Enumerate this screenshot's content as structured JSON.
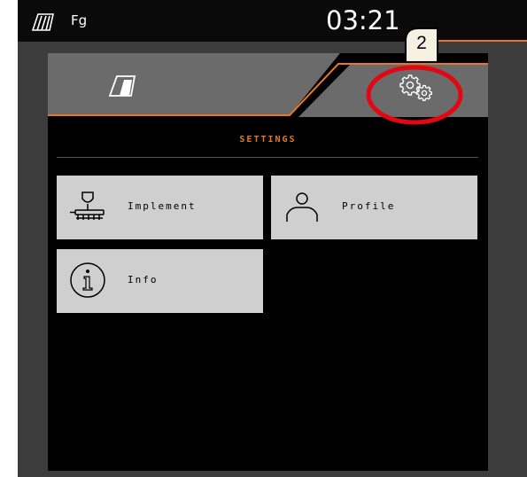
{
  "status_bar": {
    "mode": "Fg",
    "time": "03:21"
  },
  "screen": {
    "title": "SETTINGS",
    "header_icon": "machine-logo-icon",
    "settings_icon": "gears-icon"
  },
  "tiles": [
    {
      "label": "Implement",
      "icon": "implement-icon"
    },
    {
      "label": "Profile",
      "icon": "profile-icon"
    },
    {
      "label": "Info",
      "icon": "info-icon"
    }
  ],
  "annotation": {
    "badge": "2"
  },
  "colors": {
    "accent": "#e87722",
    "header_bg": "#6b6b6b",
    "tile_bg": "#cfcfcf",
    "callout": "#e30613"
  }
}
